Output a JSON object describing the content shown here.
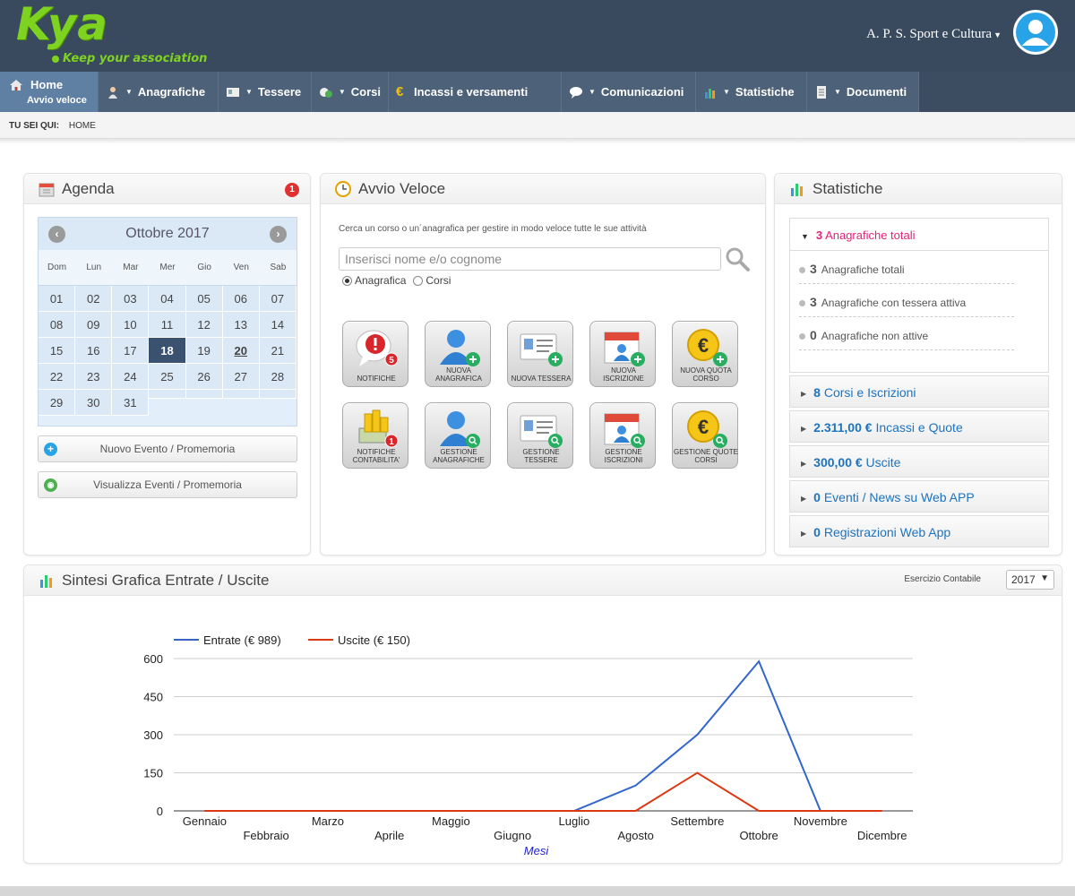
{
  "header": {
    "logo_text": "Kya",
    "logo_tagline": "Keep your association",
    "association": "A. P. S. Sport e Cultura"
  },
  "nav": {
    "home_label": "Home",
    "home_sub": "Avvio veloce",
    "items": [
      "Anagrafiche",
      "Tessere",
      "Corsi",
      "Incassi e versamenti",
      "Comunicazioni",
      "Statistiche",
      "Documenti"
    ]
  },
  "breadcrumb": {
    "label": "TU SEI QUI:",
    "current": "HOME"
  },
  "agenda": {
    "title": "Agenda",
    "badge": "1",
    "month": "Ottobre 2017",
    "weekdays": [
      "Dom",
      "Lun",
      "Mar",
      "Mer",
      "Gio",
      "Ven",
      "Sab"
    ],
    "weeks": [
      [
        "01",
        "02",
        "03",
        "04",
        "05",
        "06",
        "07"
      ],
      [
        "08",
        "09",
        "10",
        "11",
        "12",
        "13",
        "14"
      ],
      [
        "15",
        "16",
        "17",
        "18",
        "19",
        "20",
        "21"
      ],
      [
        "22",
        "23",
        "24",
        "25",
        "26",
        "27",
        "28"
      ],
      [
        "29",
        "30",
        "31",
        "",
        "",
        "",
        ""
      ]
    ],
    "today": "18",
    "marked": "20",
    "new_event": "Nuovo Evento / Promemoria",
    "view_events": "Visualizza Eventi / Promemoria"
  },
  "avvio": {
    "title": "Avvio Veloce",
    "description": "Cerca un corso o un´anagrafica per gestire in modo veloce tutte le sue attività",
    "search_placeholder": "Inserisci nome e/o cognome",
    "radio_anagrafica": "Anagrafica",
    "radio_corsi": "Corsi",
    "tiles": [
      {
        "label": "NOTIFICHE",
        "badge": "5"
      },
      {
        "label": "NUOVA ANAGRAFICA"
      },
      {
        "label": "NUOVA TESSERA"
      },
      {
        "label": "NUOVA ISCRIZIONE"
      },
      {
        "label": "NUOVA QUOTA CORSO"
      },
      {
        "label": "NOTIFICHE CONTABILITA'",
        "badge": "1"
      },
      {
        "label": "GESTIONE ANAGRAFICHE"
      },
      {
        "label": "GESTIONE TESSERE"
      },
      {
        "label": "GESTIONE ISCRIZIONI"
      },
      {
        "label": "GESTIONE QUOTE CORSI"
      }
    ]
  },
  "statistiche": {
    "title": "Statistiche",
    "open": {
      "value": "3",
      "label": "Anagrafiche totali"
    },
    "lines": [
      {
        "value": "3",
        "label": "Anagrafiche totali"
      },
      {
        "value": "3",
        "label": "Anagrafiche con tessera attiva"
      },
      {
        "value": "0",
        "label": "Anagrafiche non attive"
      }
    ],
    "rows": [
      {
        "value": "8",
        "label": "Corsi e Iscrizioni"
      },
      {
        "value": "2.311,00 €",
        "label": "Incassi e Quote"
      },
      {
        "value": "300,00 €",
        "label": "Uscite"
      },
      {
        "value": "0",
        "label": "Eventi / News su Web APP"
      },
      {
        "value": "0",
        "label": "Registrazioni Web App"
      }
    ]
  },
  "sintesi": {
    "title": "Sintesi Grafica Entrate / Uscite",
    "esercizio_label": "Esercizio Contabile",
    "year": "2017"
  },
  "chart_data": {
    "type": "line",
    "categories": [
      "Gennaio",
      "Febbraio",
      "Marzo",
      "Aprile",
      "Maggio",
      "Giugno",
      "Luglio",
      "Agosto",
      "Settembre",
      "Ottobre",
      "Novembre",
      "Dicembre"
    ],
    "series": [
      {
        "name": "Entrate (€ 989)",
        "color": "#3366cc",
        "values": [
          0,
          0,
          0,
          0,
          0,
          0,
          0,
          100,
          300,
          589,
          0,
          0
        ]
      },
      {
        "name": "Uscite (€ 150)",
        "color": "#dc3912",
        "values": [
          0,
          0,
          0,
          0,
          0,
          0,
          0,
          0,
          150,
          0,
          0,
          0
        ]
      }
    ],
    "xlabel": "Mesi",
    "yticks": [
      0,
      150,
      300,
      450,
      600
    ],
    "ylim": [
      0,
      600
    ],
    "grid": true,
    "legend": "top-left"
  },
  "colors": {
    "header_bg": "#3a4a5e",
    "nav_bg": "#4d6178",
    "accent_pink": "#e0247a",
    "link_blue": "#1e73be"
  }
}
